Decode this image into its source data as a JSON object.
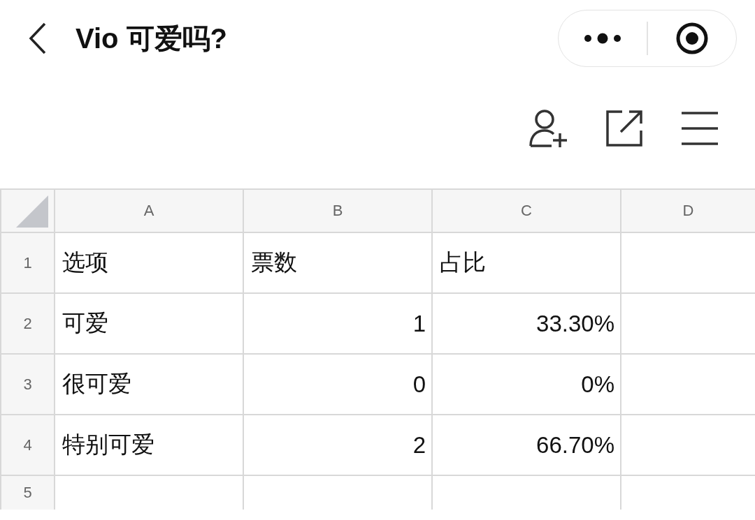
{
  "header": {
    "title": "Vio 可爱吗?"
  },
  "sheet": {
    "columns": [
      "A",
      "B",
      "C",
      "D"
    ],
    "rows": [
      {
        "number": "1",
        "cells": [
          {
            "text": "选项",
            "kind": "text"
          },
          {
            "text": "票数",
            "kind": "text"
          },
          {
            "text": "占比",
            "kind": "text"
          }
        ]
      },
      {
        "number": "2",
        "cells": [
          {
            "text": "可爱",
            "kind": "text"
          },
          {
            "text": "1",
            "kind": "number"
          },
          {
            "text": "33.30%",
            "kind": "number"
          }
        ]
      },
      {
        "number": "3",
        "cells": [
          {
            "text": "很可爱",
            "kind": "text"
          },
          {
            "text": "0",
            "kind": "number"
          },
          {
            "text": "0%",
            "kind": "number"
          }
        ]
      },
      {
        "number": "4",
        "cells": [
          {
            "text": "特别可爱",
            "kind": "text"
          },
          {
            "text": "2",
            "kind": "number"
          },
          {
            "text": "66.70%",
            "kind": "number"
          }
        ]
      },
      {
        "number": "5"
      }
    ]
  }
}
